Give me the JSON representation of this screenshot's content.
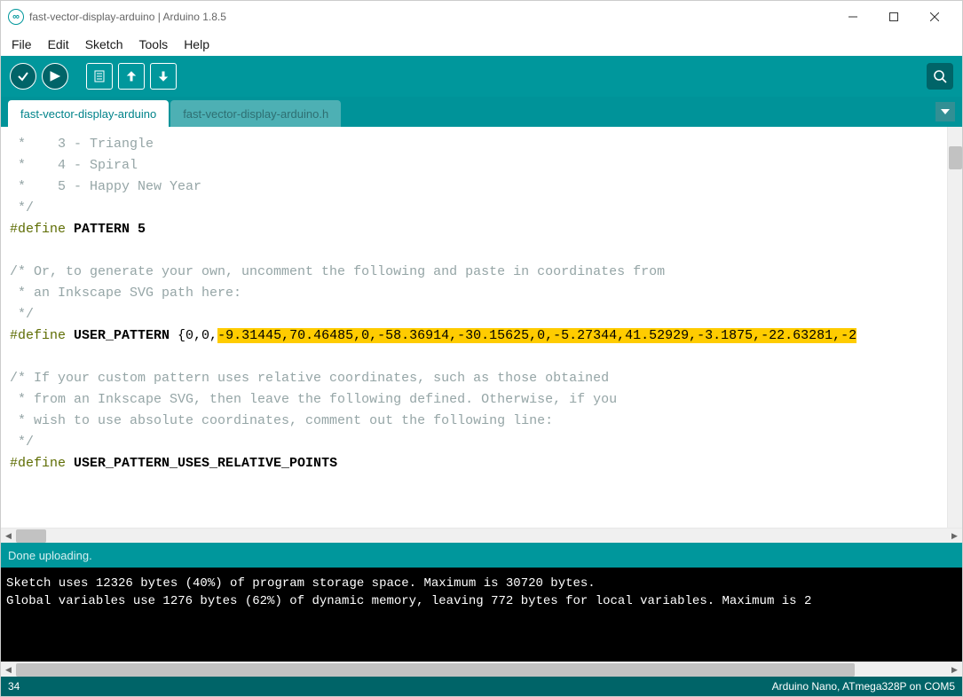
{
  "window": {
    "title": "fast-vector-display-arduino | Arduino 1.8.5"
  },
  "menubar": {
    "file": "File",
    "edit": "Edit",
    "sketch": "Sketch",
    "tools": "Tools",
    "help": "Help"
  },
  "tabs": {
    "active": "fast-vector-display-arduino",
    "inactive": "fast-vector-display-arduino.h"
  },
  "editor": {
    "l1": " *    3 - Triangle",
    "l2": " *    4 - Spiral",
    "l3": " *    5 - Happy New Year",
    "l4": " */",
    "l5_kw": "#define",
    "l5_id": " PATTERN 5",
    "l6": "",
    "l7": "/* Or, to generate your own, uncomment the following and paste in coordinates from",
    "l8": " * an Inkscape SVG path here:",
    "l9": " */",
    "l10_kw": "#define",
    "l10_id": " USER_PATTERN ",
    "l10_b1": "{0,0,",
    "l10_hl": "-9.31445,70.46485,0,-58.36914,-30.15625,0,-5.27344,41.52929,-3.1875,-22.63281,-2",
    "l11": "",
    "l12": "/* If your custom pattern uses relative coordinates, such as those obtained",
    "l13": " * from an Inkscape SVG, then leave the following defined. Otherwise, if you",
    "l14": " * wish to use absolute coordinates, comment out the following line:",
    "l15": " */",
    "l16_kw": "#define",
    "l16_id": " USER_PATTERN_USES_RELATIVE_POINTS"
  },
  "status": {
    "text": "Done uploading."
  },
  "console": {
    "line1": "Sketch uses 12326 bytes (40%) of program storage space. Maximum is 30720 bytes.",
    "line2": "Global variables use 1276 bytes (62%) of dynamic memory, leaving 772 bytes for local variables. Maximum is 2"
  },
  "footer": {
    "line": "34",
    "board": "Arduino Nano, ATmega328P on COM5"
  }
}
